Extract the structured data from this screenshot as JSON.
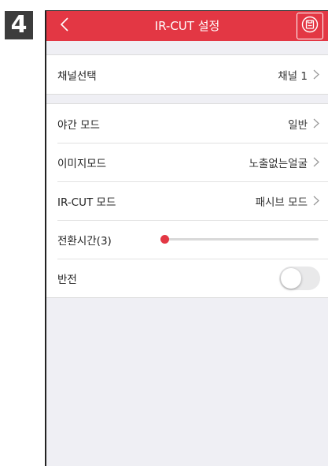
{
  "step_badge": "4",
  "header": {
    "title": "IR-CUT 설정",
    "back_icon": "chevron-left-icon",
    "save_icon": "save-icon",
    "background": "#e33744"
  },
  "channel_group": {
    "items": [
      {
        "label": "채널선택",
        "value": "채널 1"
      }
    ]
  },
  "settings_group": {
    "night_mode": {
      "label": "야간 모드",
      "value": "일반"
    },
    "image_mode": {
      "label": "이미지모드",
      "value": "노출없는얼굴"
    },
    "ircut_mode": {
      "label": "IR-CUT 모드",
      "value": "패시브 모드"
    },
    "switch_time": {
      "label": "전환시간(3)",
      "slider_value": 0
    },
    "flip": {
      "label": "반전",
      "enabled": false
    }
  }
}
